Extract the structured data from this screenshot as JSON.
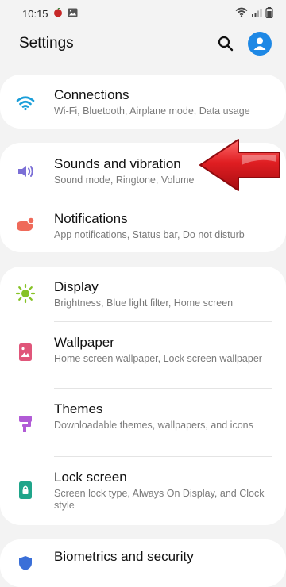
{
  "status_bar": {
    "time": "10:15"
  },
  "header": {
    "title": "Settings"
  },
  "cards": [
    {
      "items": [
        {
          "title": "Connections",
          "subtitle": "Wi-Fi, Bluetooth, Airplane mode, Data usage",
          "icon": "wifi-icon",
          "color": "#1a9ed9"
        }
      ]
    },
    {
      "items": [
        {
          "title": "Sounds and vibration",
          "subtitle": "Sound mode, Ringtone, Volume",
          "icon": "volume-icon",
          "color": "#7b6fd6"
        },
        {
          "title": "Notifications",
          "subtitle": "App notifications, Status bar, Do not disturb",
          "icon": "notifications-icon",
          "color": "#ef6a5a"
        }
      ]
    },
    {
      "items": [
        {
          "title": "Display",
          "subtitle": "Brightness, Blue light filter, Home screen",
          "icon": "display-sun-icon",
          "color": "#86c226"
        },
        {
          "title": "Wallpaper",
          "subtitle": "Home screen wallpaper, Lock screen wallpaper",
          "icon": "wallpaper-icon",
          "color": "#e0567a"
        },
        {
          "title": "Themes",
          "subtitle": "Downloadable themes, wallpapers, and icons",
          "icon": "themes-icon",
          "color": "#b15bd6"
        },
        {
          "title": "Lock screen",
          "subtitle": "Screen lock type, Always On Display, and Clock style",
          "icon": "lock-icon",
          "color": "#1fa58a"
        }
      ]
    },
    {
      "items": [
        {
          "title": "Biometrics and security",
          "subtitle": "",
          "icon": "biometrics-icon",
          "color": "#3a6fd8"
        }
      ]
    }
  ],
  "annotation": {
    "color": "#d0141a"
  }
}
